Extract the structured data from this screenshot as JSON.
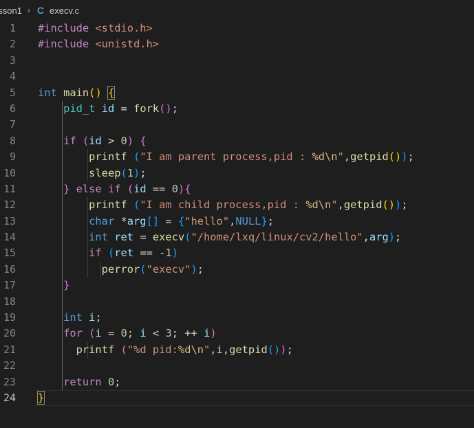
{
  "breadcrumb": {
    "folder": "esson1",
    "file": "execv.c",
    "file_icon": "C"
  },
  "editor": {
    "current_line": 24,
    "lines": [
      {
        "n": "1",
        "t": [
          [
            "pp",
            "#include "
          ],
          [
            "str",
            "<stdio.h>"
          ]
        ]
      },
      {
        "n": "2",
        "t": [
          [
            "pp",
            "#include "
          ],
          [
            "str",
            "<unistd.h>"
          ]
        ]
      },
      {
        "n": "3",
        "t": []
      },
      {
        "n": "4",
        "t": []
      },
      {
        "n": "5",
        "t": [
          [
            "kw",
            "int"
          ],
          [
            "pl",
            " "
          ],
          [
            "fn",
            "main"
          ],
          [
            "b1",
            "()"
          ],
          [
            "pl",
            " "
          ],
          [
            "b1",
            "{",
            true
          ]
        ]
      },
      {
        "n": "6",
        "g": 1,
        "t": [
          [
            "pl",
            "    "
          ],
          [
            "typ",
            "pid_t"
          ],
          [
            "pl",
            " "
          ],
          [
            "var",
            "id"
          ],
          [
            "pl",
            " = "
          ],
          [
            "fn",
            "fork"
          ],
          [
            "b2",
            "()"
          ],
          [
            "pl",
            ";"
          ]
        ]
      },
      {
        "n": "7",
        "g": 1,
        "t": []
      },
      {
        "n": "8",
        "g": 1,
        "t": [
          [
            "pl",
            "    "
          ],
          [
            "ctl",
            "if"
          ],
          [
            "pl",
            " "
          ],
          [
            "b2",
            "("
          ],
          [
            "var",
            "id"
          ],
          [
            "pl",
            " > "
          ],
          [
            "num",
            "0"
          ],
          [
            "b2",
            ")"
          ],
          [
            "pl",
            " "
          ],
          [
            "b2",
            "{"
          ]
        ]
      },
      {
        "n": "9",
        "g": 2,
        "t": [
          [
            "pl",
            "        "
          ],
          [
            "fn",
            "printf"
          ],
          [
            "pl",
            " "
          ],
          [
            "b3",
            "("
          ],
          [
            "str",
            "\"I am parent process,pid : "
          ],
          [
            "esc",
            "%d\\n"
          ],
          [
            "str",
            "\""
          ],
          [
            "pl",
            ","
          ],
          [
            "fn",
            "getpid"
          ],
          [
            "b1",
            "()"
          ],
          [
            "b3",
            ")"
          ],
          [
            "pl",
            ";"
          ]
        ]
      },
      {
        "n": "10",
        "g": 2,
        "t": [
          [
            "pl",
            "        "
          ],
          [
            "fn",
            "sleep"
          ],
          [
            "b3",
            "("
          ],
          [
            "num",
            "1"
          ],
          [
            "b3",
            ")"
          ],
          [
            "pl",
            ";"
          ]
        ]
      },
      {
        "n": "11",
        "g": 1,
        "t": [
          [
            "pl",
            "    "
          ],
          [
            "b2",
            "}"
          ],
          [
            "pl",
            " "
          ],
          [
            "ctl",
            "else if"
          ],
          [
            "pl",
            " "
          ],
          [
            "b2",
            "("
          ],
          [
            "var",
            "id"
          ],
          [
            "pl",
            " == "
          ],
          [
            "num",
            "0"
          ],
          [
            "b2",
            ")"
          ],
          [
            "b2",
            "{"
          ]
        ]
      },
      {
        "n": "12",
        "g": 2,
        "t": [
          [
            "pl",
            "        "
          ],
          [
            "fn",
            "printf"
          ],
          [
            "pl",
            " "
          ],
          [
            "b3",
            "("
          ],
          [
            "str",
            "\"I am child process,pid : "
          ],
          [
            "esc",
            "%d\\n"
          ],
          [
            "str",
            "\""
          ],
          [
            "pl",
            ","
          ],
          [
            "fn",
            "getpid"
          ],
          [
            "b1",
            "()"
          ],
          [
            "b3",
            ")"
          ],
          [
            "pl",
            ";"
          ]
        ]
      },
      {
        "n": "13",
        "g": 2,
        "t": [
          [
            "pl",
            "        "
          ],
          [
            "kw",
            "char"
          ],
          [
            "pl",
            " *"
          ],
          [
            "var",
            "arg"
          ],
          [
            "b3",
            "[]"
          ],
          [
            "pl",
            " = "
          ],
          [
            "b3",
            "{"
          ],
          [
            "str",
            "\"hello\""
          ],
          [
            "pl",
            ","
          ],
          [
            "mac",
            "NULL"
          ],
          [
            "b3",
            "}"
          ],
          [
            "pl",
            ";"
          ]
        ]
      },
      {
        "n": "14",
        "g": 2,
        "t": [
          [
            "pl",
            "        "
          ],
          [
            "kw",
            "int"
          ],
          [
            "pl",
            " "
          ],
          [
            "var",
            "ret"
          ],
          [
            "pl",
            " = "
          ],
          [
            "fn",
            "execv"
          ],
          [
            "b3",
            "("
          ],
          [
            "str",
            "\"/home/lxq/linux/cv2/hello\""
          ],
          [
            "pl",
            ","
          ],
          [
            "var",
            "arg"
          ],
          [
            "b3",
            ")"
          ],
          [
            "pl",
            ";"
          ]
        ]
      },
      {
        "n": "15",
        "g": 2,
        "t": [
          [
            "pl",
            "        "
          ],
          [
            "ctl",
            "if"
          ],
          [
            "pl",
            " "
          ],
          [
            "b3",
            "("
          ],
          [
            "var",
            "ret"
          ],
          [
            "pl",
            " == -"
          ],
          [
            "num",
            "1"
          ],
          [
            "b3",
            ")"
          ]
        ]
      },
      {
        "n": "16",
        "g": 3,
        "t": [
          [
            "pl",
            "          "
          ],
          [
            "fn",
            "perror"
          ],
          [
            "b3",
            "("
          ],
          [
            "str",
            "\"execv\""
          ],
          [
            "b3",
            ")"
          ],
          [
            "pl",
            ";"
          ]
        ]
      },
      {
        "n": "17",
        "g": 1,
        "t": [
          [
            "pl",
            "    "
          ],
          [
            "b2",
            "}"
          ]
        ]
      },
      {
        "n": "18",
        "g": 1,
        "t": []
      },
      {
        "n": "19",
        "g": 1,
        "t": [
          [
            "pl",
            "    "
          ],
          [
            "kw",
            "int"
          ],
          [
            "pl",
            " "
          ],
          [
            "var",
            "i"
          ],
          [
            "pl",
            ";"
          ]
        ]
      },
      {
        "n": "20",
        "g": 1,
        "t": [
          [
            "pl",
            "    "
          ],
          [
            "ctl",
            "for"
          ],
          [
            "pl",
            " "
          ],
          [
            "b2",
            "("
          ],
          [
            "var",
            "i"
          ],
          [
            "pl",
            " = "
          ],
          [
            "num",
            "0"
          ],
          [
            "pl",
            "; "
          ],
          [
            "var",
            "i"
          ],
          [
            "pl",
            " < "
          ],
          [
            "num",
            "3"
          ],
          [
            "pl",
            "; ++ "
          ],
          [
            "var",
            "i"
          ],
          [
            "b2",
            ")"
          ]
        ]
      },
      {
        "n": "21",
        "g": 2,
        "t": [
          [
            "pl",
            "      "
          ],
          [
            "fn",
            "printf"
          ],
          [
            "pl",
            " "
          ],
          [
            "b2",
            "("
          ],
          [
            "str",
            "\"%d pid:"
          ],
          [
            "esc",
            "%d\\n"
          ],
          [
            "str",
            "\""
          ],
          [
            "pl",
            ","
          ],
          [
            "var",
            "i"
          ],
          [
            "pl",
            ","
          ],
          [
            "fn",
            "getpid"
          ],
          [
            "b3",
            "()"
          ],
          [
            "b2",
            ")"
          ],
          [
            "pl",
            ";"
          ]
        ]
      },
      {
        "n": "22",
        "g": 1,
        "t": []
      },
      {
        "n": "23",
        "g": 1,
        "t": [
          [
            "pl",
            "    "
          ],
          [
            "ctl",
            "return"
          ],
          [
            "pl",
            " "
          ],
          [
            "num",
            "0"
          ],
          [
            "pl",
            ";"
          ]
        ]
      },
      {
        "n": "24",
        "t": [
          [
            "b1",
            "}",
            true
          ]
        ]
      }
    ]
  }
}
